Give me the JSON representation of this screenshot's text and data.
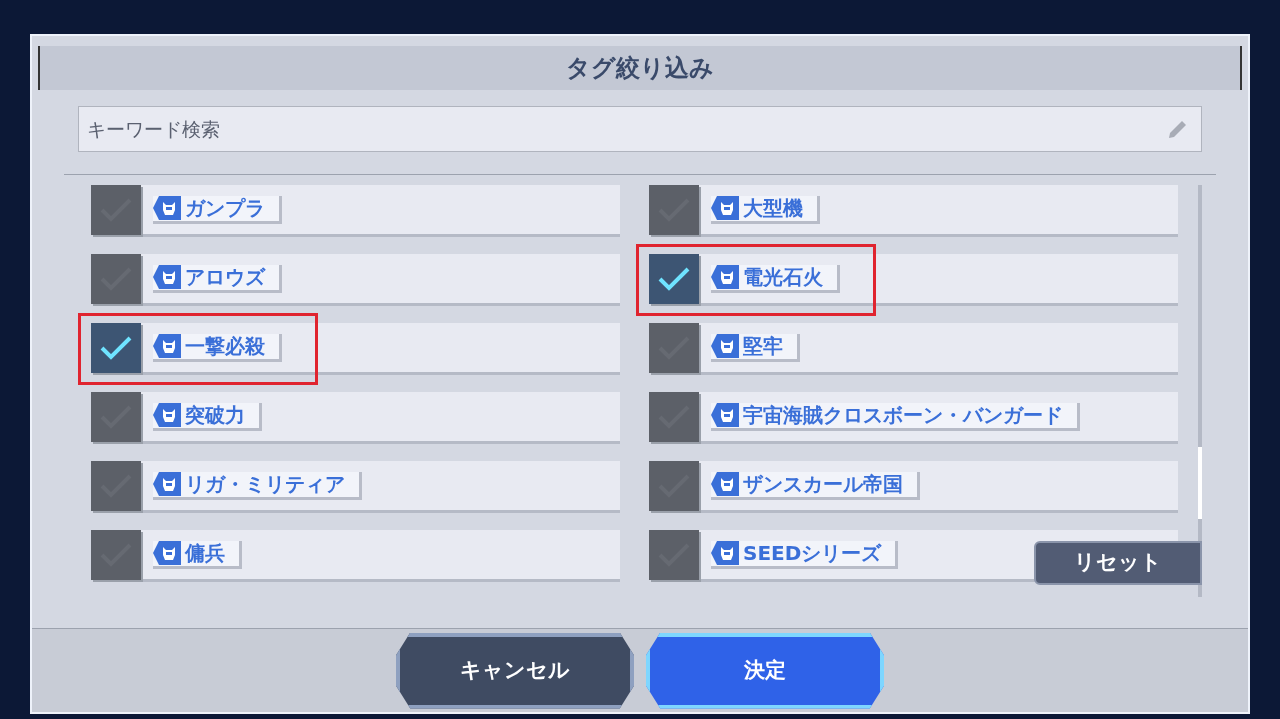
{
  "dialog": {
    "title": "タグ絞り込み"
  },
  "search": {
    "placeholder": "キーワード検索"
  },
  "tags": [
    {
      "label": "ガンプラ",
      "checked": false,
      "highlighted": false
    },
    {
      "label": "大型機",
      "checked": false,
      "highlighted": false
    },
    {
      "label": "アロウズ",
      "checked": false,
      "highlighted": false
    },
    {
      "label": "電光石火",
      "checked": true,
      "highlighted": true
    },
    {
      "label": "一撃必殺",
      "checked": true,
      "highlighted": true
    },
    {
      "label": "堅牢",
      "checked": false,
      "highlighted": false
    },
    {
      "label": "突破力",
      "checked": false,
      "highlighted": false
    },
    {
      "label": "宇宙海賊クロスボーン・バンガード",
      "checked": false,
      "highlighted": false
    },
    {
      "label": "リガ・ミリティア",
      "checked": false,
      "highlighted": false
    },
    {
      "label": "ザンスカール帝国",
      "checked": false,
      "highlighted": false
    },
    {
      "label": "傭兵",
      "checked": false,
      "highlighted": false
    },
    {
      "label": "SEEDシリーズ",
      "checked": false,
      "highlighted": false
    }
  ],
  "reset_button": "リセット",
  "buttons": [
    {
      "label": "キャンセル",
      "kind": "secondary"
    },
    {
      "label": "決定",
      "kind": "primary"
    }
  ]
}
